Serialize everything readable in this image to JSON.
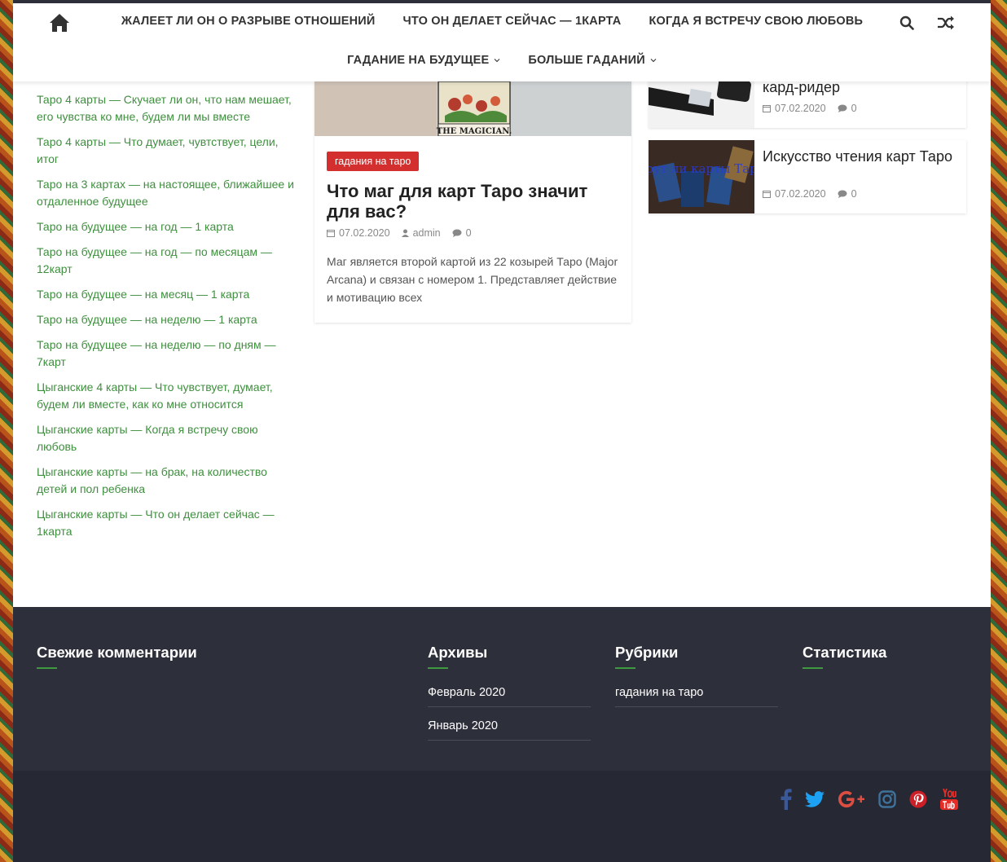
{
  "header": {
    "nav_row1": [
      "ЖАЛЕЕТ ЛИ ОН О РАЗРЫВЕ ОТНОШЕНИЙ",
      "ЧТО ОН ДЕЛАЕТ СЕЙЧАС — 1КАРТА",
      "КОГДА Я ВСТРЕЧУ СВОЮ ЛЮБОВЬ"
    ],
    "nav_row2": [
      "ГАДАНИЕ НА БУДУЩЕЕ",
      "БОЛЬШЕ ГАДАНИЙ"
    ],
    "icons": [
      "home-icon",
      "search-icon",
      "shuffle-icon",
      "chevron-down-icon"
    ]
  },
  "sidebar": {
    "links": [
      "Таро 4 карты — Скучает ли он, что нам мешает, его чувства ко мне, будем ли мы вместе",
      "Таро 4 карты — Что думает, чувтствует, цели, итог",
      "Таро на 3 картах — на настоящее, ближайшее и отдаленное будущее",
      "Таро на будущее — на год — 1 карта",
      "Таро на будущее — на год — по месяцам — 12карт",
      "Таро на будущее — на месяц — 1 карта",
      "Таро на будущее — на неделю — 1 карта",
      "Таро на будущее — на неделю — по дням — 7карт",
      "Цыганские 4 карты — Что чувствует, думает, будем ли вместе, как ко мне относится",
      "Цыганские карты — Когда я встречу свою любовь",
      "Цыганские карты — на брак, на количество детей и пол ребенка",
      "Цыганские карты — Что он делает сейчас — 1карта"
    ]
  },
  "main_post": {
    "image_caption": "THE MAGICIAN.",
    "tag": "гадания на таро",
    "title": "Что маг для карт Таро значит для вас?",
    "date": "07.02.2020",
    "author": "admin",
    "comments": "0",
    "excerpt": "Маг является второй картой из 22 козырей Таро (Major Arcana) и связан с номером 1. Представляет действие и мотивацию всех"
  },
  "side_posts": [
    {
      "title": "кард-ридер",
      "date": "07.02.2020",
      "comments": "0"
    },
    {
      "title": "Искусство чтения карт Таро",
      "date": "07.02.2020",
      "comments": "0",
      "thumb_text": "Врут ли карты Таро"
    }
  ],
  "footer": {
    "recent_comments_title": "Свежие комментарии",
    "archives_title": "Архивы",
    "archives": [
      "Февраль 2020",
      "Январь 2020"
    ],
    "categories_title": "Рубрики",
    "categories": [
      "гадания на таро"
    ],
    "stats_title": "Статистика",
    "accent_color": "#3e9a3e"
  },
  "social": [
    "facebook-icon",
    "twitter-icon",
    "google-plus-icon",
    "instagram-icon",
    "pinterest-icon",
    "youtube-icon"
  ],
  "colors": {
    "link": "#3e8f3e",
    "tag": "#d32f2f",
    "footer_bg": "#2d2f3b"
  }
}
